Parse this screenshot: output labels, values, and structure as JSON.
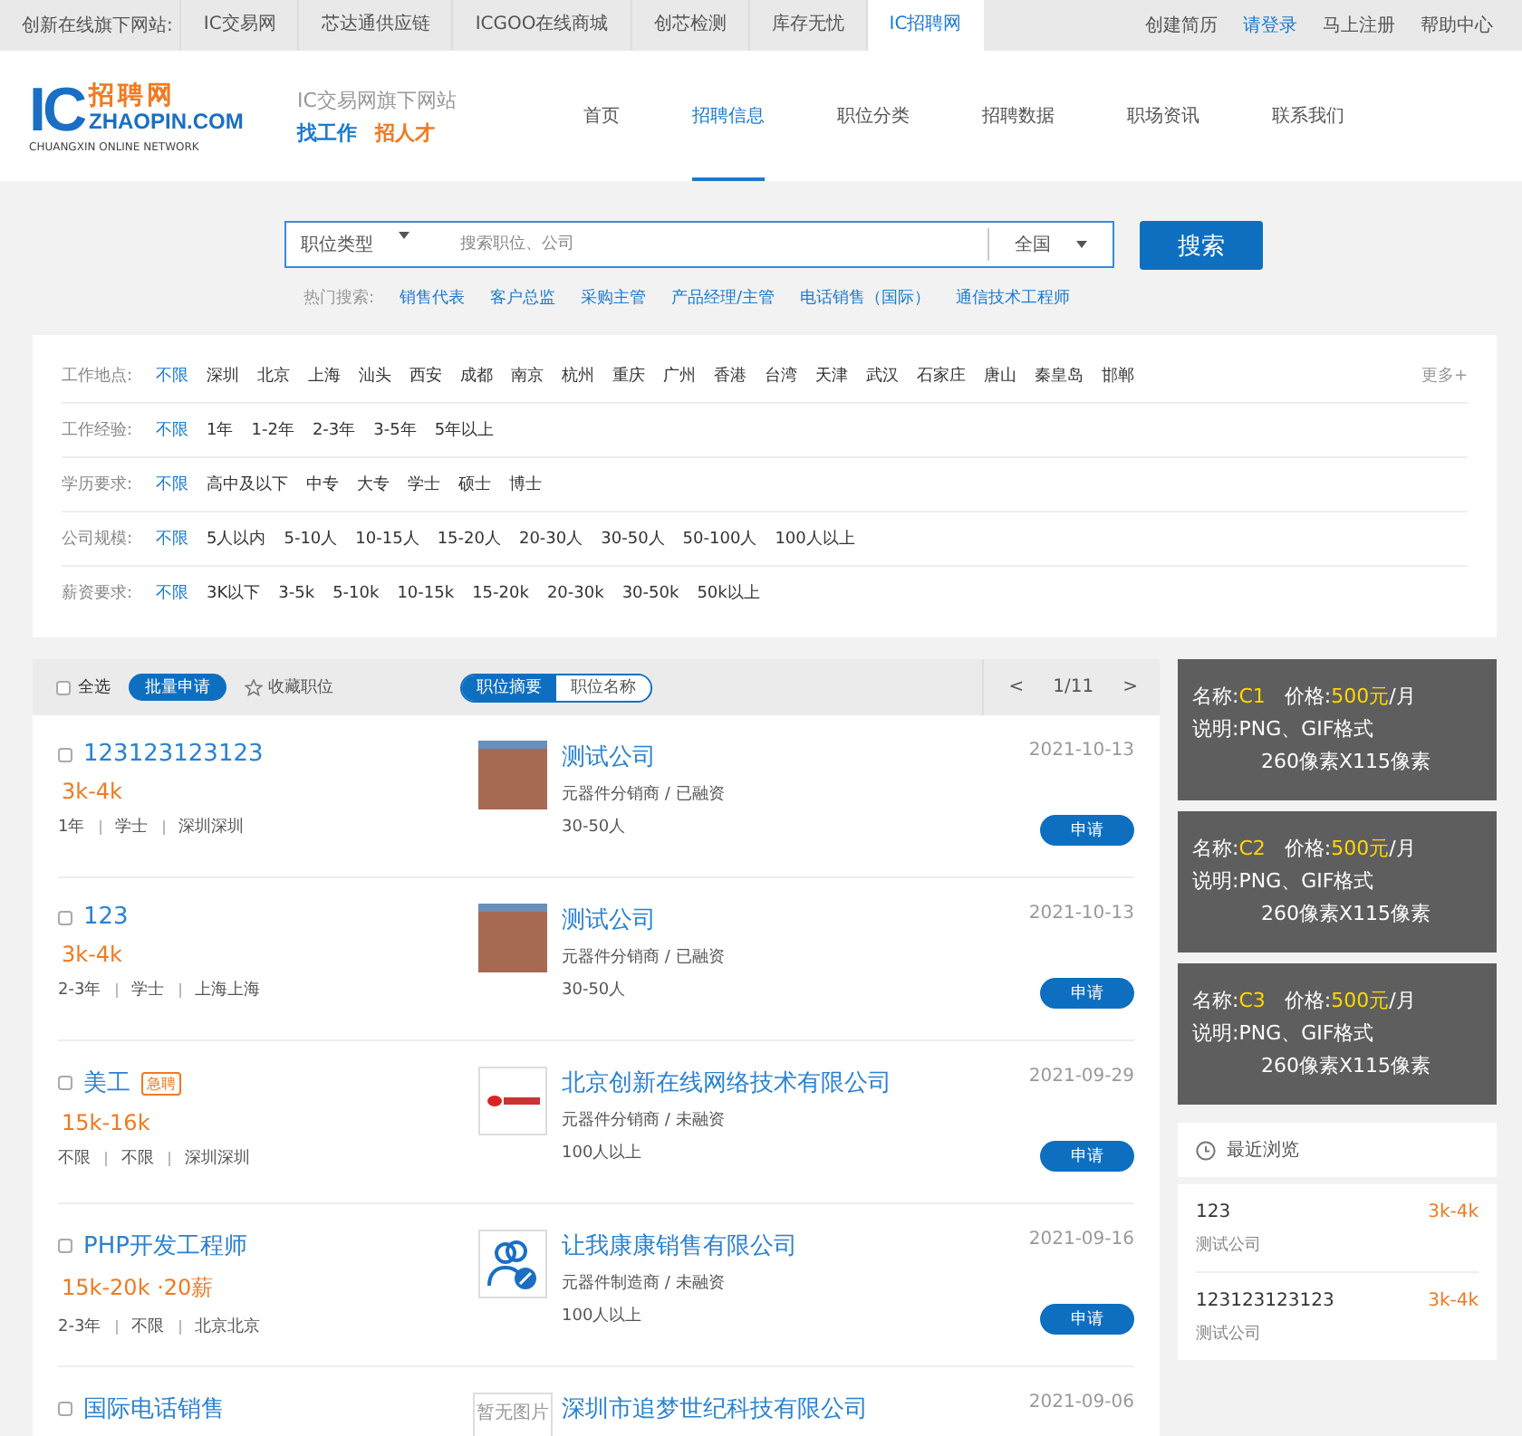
{
  "top_bar": {
    "label": "创新在线旗下网站:",
    "sites": [
      {
        "label": "IC交易网",
        "selected": false
      },
      {
        "label": "芯达通供应链",
        "selected": false
      },
      {
        "label": "ICGOO在线商城",
        "selected": false
      },
      {
        "label": "创芯检测",
        "selected": false
      },
      {
        "label": "库存无忧",
        "selected": false
      },
      {
        "label": "IC招聘网",
        "selected": true
      }
    ],
    "links": [
      {
        "label": "创建简历",
        "kind": "plain"
      },
      {
        "label": "请登录",
        "kind": "primary"
      },
      {
        "label": "马上注册",
        "kind": "plain"
      },
      {
        "label": "帮助中心",
        "kind": "plain"
      }
    ]
  },
  "header": {
    "logo": {
      "mark": "IC",
      "name": "招聘网",
      "domain": "ZHAOPIN.COM",
      "tagline": "CHUANGXIN ONLINE NETWORK"
    },
    "slogan": {
      "subtitle": "IC交易网旗下网站",
      "find_job": "找工作",
      "hire": "招人才"
    },
    "nav": [
      {
        "label": "首页",
        "selected": false
      },
      {
        "label": "招聘信息",
        "selected": true
      },
      {
        "label": "职位分类",
        "selected": false
      },
      {
        "label": "招聘数据",
        "selected": false
      },
      {
        "label": "职场资讯",
        "selected": false
      },
      {
        "label": "联系我们",
        "selected": false
      }
    ]
  },
  "search": {
    "category": "职位类型",
    "placeholder": "搜索职位、公司",
    "region": "全国",
    "button": "搜索",
    "hot_label": "热门搜索:",
    "hot": [
      "销售代表",
      "客户总监",
      "采购主管",
      "产品经理/主管",
      "电话销售（国际）",
      "通信技术工程师"
    ]
  },
  "filters": [
    {
      "label": "工作地点:",
      "options": [
        {
          "label": "不限",
          "selected": true
        },
        {
          "label": "深圳",
          "selected": false
        },
        {
          "label": "北京",
          "selected": false
        },
        {
          "label": "上海",
          "selected": false
        },
        {
          "label": "汕头",
          "selected": false
        },
        {
          "label": "西安",
          "selected": false
        },
        {
          "label": "成都",
          "selected": false
        },
        {
          "label": "南京",
          "selected": false
        },
        {
          "label": "杭州",
          "selected": false
        },
        {
          "label": "重庆",
          "selected": false
        },
        {
          "label": "广州",
          "selected": false
        },
        {
          "label": "香港",
          "selected": false
        },
        {
          "label": "台湾",
          "selected": false
        },
        {
          "label": "天津",
          "selected": false
        },
        {
          "label": "武汉",
          "selected": false
        },
        {
          "label": "石家庄",
          "selected": false
        },
        {
          "label": "唐山",
          "selected": false
        },
        {
          "label": "秦皇岛",
          "selected": false
        },
        {
          "label": "邯郸",
          "selected": false
        }
      ],
      "more": "更多+"
    },
    {
      "label": "工作经验:",
      "options": [
        {
          "label": "不限",
          "selected": true
        },
        {
          "label": "1年",
          "selected": false
        },
        {
          "label": "1-2年",
          "selected": false
        },
        {
          "label": "2-3年",
          "selected": false
        },
        {
          "label": "3-5年",
          "selected": false
        },
        {
          "label": "5年以上",
          "selected": false
        }
      ]
    },
    {
      "label": "学历要求:",
      "options": [
        {
          "label": "不限",
          "selected": true
        },
        {
          "label": "高中及以下",
          "selected": false
        },
        {
          "label": "中专",
          "selected": false
        },
        {
          "label": "大专",
          "selected": false
        },
        {
          "label": "学士",
          "selected": false
        },
        {
          "label": "硕士",
          "selected": false
        },
        {
          "label": "博士",
          "selected": false
        }
      ]
    },
    {
      "label": "公司规模:",
      "options": [
        {
          "label": "不限",
          "selected": true
        },
        {
          "label": "5人以内",
          "selected": false
        },
        {
          "label": "5-10人",
          "selected": false
        },
        {
          "label": "10-15人",
          "selected": false
        },
        {
          "label": "15-20人",
          "selected": false
        },
        {
          "label": "20-30人",
          "selected": false
        },
        {
          "label": "30-50人",
          "selected": false
        },
        {
          "label": "50-100人",
          "selected": false
        },
        {
          "label": "100人以上",
          "selected": false
        }
      ]
    },
    {
      "label": "薪资要求:",
      "options": [
        {
          "label": "不限",
          "selected": true
        },
        {
          "label": "3K以下",
          "selected": false
        },
        {
          "label": "3-5k",
          "selected": false
        },
        {
          "label": "5-10k",
          "selected": false
        },
        {
          "label": "10-15k",
          "selected": false
        },
        {
          "label": "15-20k",
          "selected": false
        },
        {
          "label": "20-30k",
          "selected": false
        },
        {
          "label": "30-50k",
          "selected": false
        },
        {
          "label": "50k以上",
          "selected": false
        }
      ]
    }
  ],
  "list_toolbar": {
    "select_all": "全选",
    "checked": false,
    "batch_apply": "批量申请",
    "favorite": "收藏职位",
    "views": [
      {
        "label": "职位摘要",
        "selected": true
      },
      {
        "label": "职位名称",
        "selected": false
      }
    ],
    "prev": "<",
    "page": "1/11",
    "next": ">"
  },
  "jobs": [
    {
      "title": "123123123123",
      "checked": false,
      "salary": "3k-4k",
      "meta": [
        "1年",
        "学士",
        "深圳深圳"
      ],
      "logo": {
        "kind": "photo"
      },
      "company": "测试公司",
      "company_info": "元器件分销商 / 已融资",
      "size": "30-50人",
      "date": "2021-10-13",
      "apply": "申请"
    },
    {
      "title": "123",
      "checked": false,
      "salary": "3k-4k",
      "meta": [
        "2-3年",
        "学士",
        "上海上海"
      ],
      "logo": {
        "kind": "photo"
      },
      "company": "测试公司",
      "company_info": "元器件分销商 / 已融资",
      "size": "30-50人",
      "date": "2021-10-13",
      "apply": "申请"
    },
    {
      "title": "美工",
      "tag": "急聘",
      "checked": false,
      "salary": "15k-16k",
      "meta": [
        "不限",
        "不限",
        "深圳深圳"
      ],
      "logo": {
        "kind": "brand"
      },
      "company": "北京创新在线网络技术有限公司",
      "company_info": "元器件分销商 / 未融资",
      "size": "100人以上",
      "date": "2021-09-29",
      "apply": "申请"
    },
    {
      "title": "PHP开发工程师",
      "checked": false,
      "salary": "15k-20k ·20薪",
      "meta": [
        "2-3年",
        "不限",
        "北京北京"
      ],
      "logo": {
        "kind": "people"
      },
      "company": "让我康康销售有限公司",
      "company_info": "元器件制造商 / 未融资",
      "size": "100人以上",
      "date": "2021-09-16",
      "apply": "申请"
    },
    {
      "title": "国际电话销售",
      "checked": false,
      "logo": {
        "kind": "none",
        "text": "暂无图片"
      },
      "company": "深圳市追梦世纪科技有限公司",
      "date": "2021-09-06"
    }
  ],
  "ads": [
    {
      "name_label": "名称:",
      "name": "C1",
      "price_label": "价格:",
      "price": "500元",
      "unit": "/月",
      "desc_label": "说明:",
      "desc": "PNG、GIF格式",
      "size": "260像素X115像素"
    },
    {
      "name_label": "名称:",
      "name": "C2",
      "price_label": "价格:",
      "price": "500元",
      "unit": "/月",
      "desc_label": "说明:",
      "desc": "PNG、GIF格式",
      "size": "260像素X115像素"
    },
    {
      "name_label": "名称:",
      "name": "C3",
      "price_label": "价格:",
      "price": "500元",
      "unit": "/月",
      "desc_label": "说明:",
      "desc": "PNG、GIF格式",
      "size": "260像素X115像素"
    }
  ],
  "recent": {
    "title": "最近浏览",
    "items": [
      {
        "title": "123",
        "company": "测试公司",
        "salary": "3k-4k"
      },
      {
        "title": "123123123123",
        "company": "测试公司",
        "salary": "3k-4k"
      }
    ]
  }
}
